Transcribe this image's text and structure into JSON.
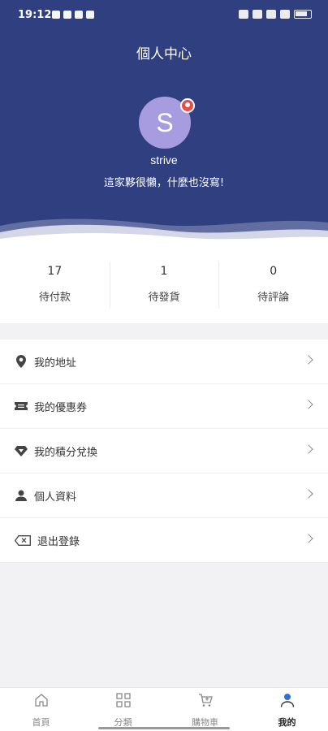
{
  "status_bar": {
    "time": "19:12"
  },
  "header": {
    "title": "個人中心",
    "avatar_letter": "S",
    "username": "strive",
    "signature": "這家夥很懶，什麼也沒寫!"
  },
  "orders": [
    {
      "count": "17",
      "label": "待付款"
    },
    {
      "count": "1",
      "label": "待發貨"
    },
    {
      "count": "0",
      "label": "待評論"
    }
  ],
  "menu": [
    {
      "label": "我的地址",
      "icon": "location-pin-icon"
    },
    {
      "label": "我的優惠券",
      "icon": "coupon-icon"
    },
    {
      "label": "我的積分兌換",
      "icon": "diamond-icon"
    },
    {
      "label": "個人資料",
      "icon": "person-icon"
    },
    {
      "label": "退出登錄",
      "icon": "logout-icon"
    }
  ],
  "tabs": [
    {
      "label": "首頁",
      "icon": "home-icon"
    },
    {
      "label": "分類",
      "icon": "grid-icon"
    },
    {
      "label": "購物車",
      "icon": "cart-icon"
    },
    {
      "label": "我的",
      "icon": "profile-icon",
      "active": true
    }
  ],
  "colors": {
    "header_bg": "#303f7f",
    "avatar_bg": "#a79ce0",
    "badge": "#e94a4a"
  }
}
